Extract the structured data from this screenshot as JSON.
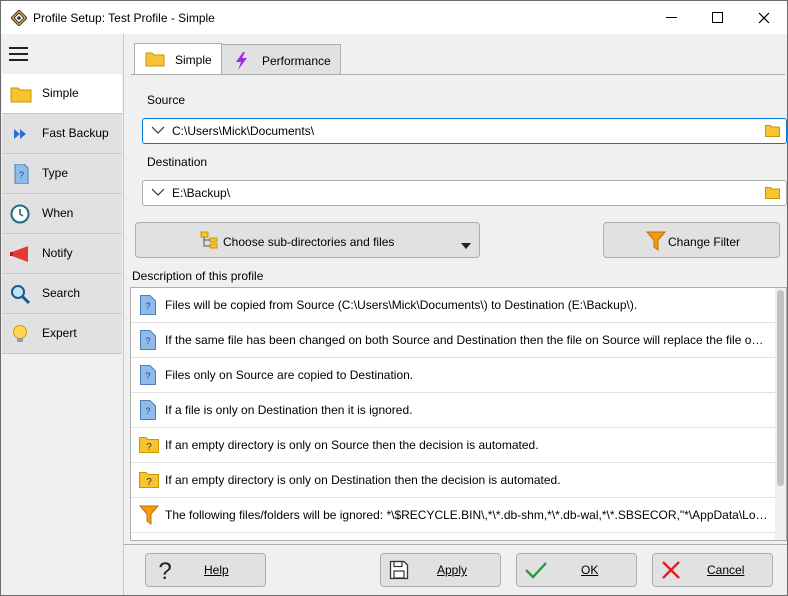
{
  "window": {
    "title": "Profile Setup: Test Profile - Simple",
    "minimize": "—",
    "maximize": "☐",
    "close": "✕"
  },
  "sidebar": {
    "items": [
      {
        "label": "Simple",
        "icon": "folder-icon"
      },
      {
        "label": "Fast Backup",
        "icon": "fast-forward-icon"
      },
      {
        "label": "Type",
        "icon": "question-document-icon"
      },
      {
        "label": "When",
        "icon": "clock-icon"
      },
      {
        "label": "Notify",
        "icon": "megaphone-icon"
      },
      {
        "label": "Search",
        "icon": "magnifier-icon"
      },
      {
        "label": "Expert",
        "icon": "lightbulb-icon"
      }
    ]
  },
  "tabs": [
    {
      "label": "Simple",
      "icon": "folder-icon"
    },
    {
      "label": "Performance",
      "icon": "lightning-icon"
    }
  ],
  "source": {
    "label": "Source",
    "value": "C:\\Users\\Mick\\Documents\\"
  },
  "destination": {
    "label": "Destination",
    "value": "E:\\Backup\\"
  },
  "buttons": {
    "choose_subdirs": "Choose sub-directories and files",
    "change_filter": "Change Filter",
    "help": "Help",
    "apply": "Apply",
    "ok": "OK",
    "cancel": "Cancel"
  },
  "description": {
    "label": "Description of this profile",
    "rows": [
      {
        "icon": "question-document-icon",
        "text": "Files will be copied from Source (C:\\Users\\Mick\\Documents\\) to Destination (E:\\Backup\\)."
      },
      {
        "icon": "question-document-icon",
        "text": "If the same file has been changed on both Source and Destination then the file on Source will replace the file on D..."
      },
      {
        "icon": "question-document-icon",
        "text": "Files only on Source are copied to Destination."
      },
      {
        "icon": "question-document-icon",
        "text": "If a file is only on Destination then it is ignored."
      },
      {
        "icon": "question-folder-icon",
        "text": "If an empty directory is only on Source then the decision is automated."
      },
      {
        "icon": "question-folder-icon",
        "text": "If an empty directory is only on Destination then the decision is automated."
      },
      {
        "icon": "filter-icon",
        "text": "The following files/folders will be ignored: *\\$RECYCLE.BIN\\,*\\*.db-shm,*\\*.db-wal,*\\*.SBSECOR,\"*\\AppData\\Loc..."
      }
    ]
  },
  "colors": {
    "accent": "#0078d7",
    "folder": "#f6c431",
    "doc_blue": "#6fa8dc",
    "filter_orange": "#f39c12",
    "lightning": "#9b30d9"
  }
}
